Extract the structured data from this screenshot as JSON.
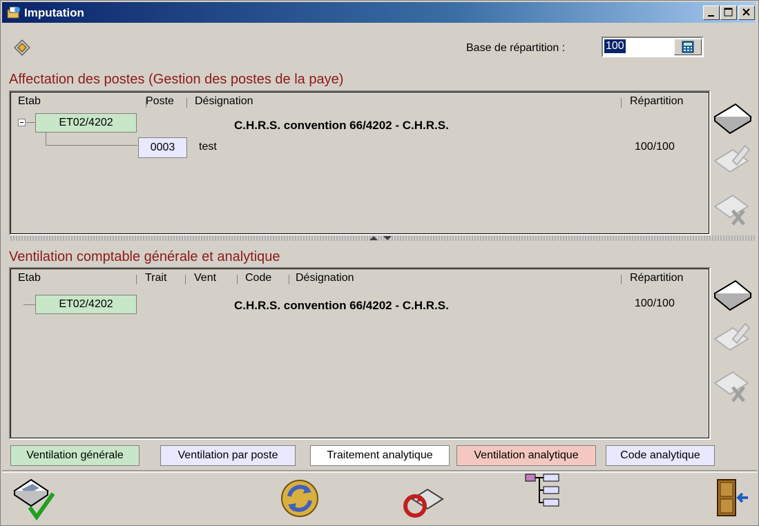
{
  "window": {
    "title": "Imputation"
  },
  "base": {
    "label": "Base de répartition :",
    "value": "100"
  },
  "section1": {
    "title": "Affectation des postes (Gestion des postes de la paye)",
    "headers": {
      "etab": "Etab",
      "poste": "Poste",
      "designation": "Désignation",
      "repartition": "Répartition"
    },
    "etab": "ET02/4202",
    "etab_designation": "C.H.R.S. convention 66/4202 - C.H.R.S.",
    "child": {
      "poste": "0003",
      "designation": "test",
      "repartition": "100/100"
    }
  },
  "section2": {
    "title": "Ventilation comptable générale et analytique",
    "headers": {
      "etab": "Etab",
      "trait": "Trait",
      "vent": "Vent",
      "code": "Code",
      "designation": "Désignation",
      "repartition": "Répartition"
    },
    "etab": "ET02/4202",
    "etab_designation": "C.H.R.S. convention 66/4202 - C.H.R.S.",
    "repartition": "100/100"
  },
  "legend": {
    "generale": "Ventilation générale",
    "par_poste": "Ventilation par poste",
    "traitement": "Traitement analytique",
    "analytique": "Ventilation analytique",
    "code": "Code analytique"
  },
  "colors": {
    "generale": "#c8e6c8",
    "par_poste": "#e8e8ff",
    "traitement": "#ffffff",
    "analytique": "#f4c8c0",
    "code": "#e8e8ff",
    "section_title": "#8b1a1a"
  },
  "icons": {
    "app": "app-icon",
    "tool": "tool-icon",
    "add": "add-icon",
    "edit": "edit-icon",
    "delete": "delete-icon",
    "validate": "validate-icon",
    "refresh": "refresh-icon",
    "cancel": "cancel-icon",
    "tree": "tree-icon",
    "exit": "exit-door-icon"
  }
}
